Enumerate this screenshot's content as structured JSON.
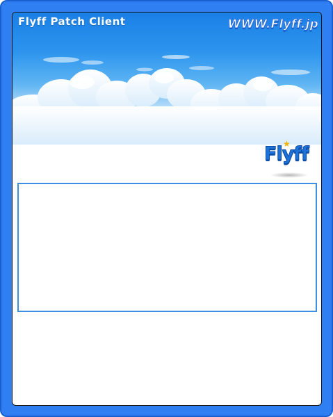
{
  "window": {
    "title": "Flyff Patch Client",
    "site_link": "WWW.Flyff.jp"
  },
  "logo": {
    "text": "Flyff"
  },
  "log": {
    "content": ""
  },
  "colors": {
    "frame": "#2f7ef2",
    "sky_top": "#1a7fe6",
    "log_border": "#3b8fe0"
  }
}
